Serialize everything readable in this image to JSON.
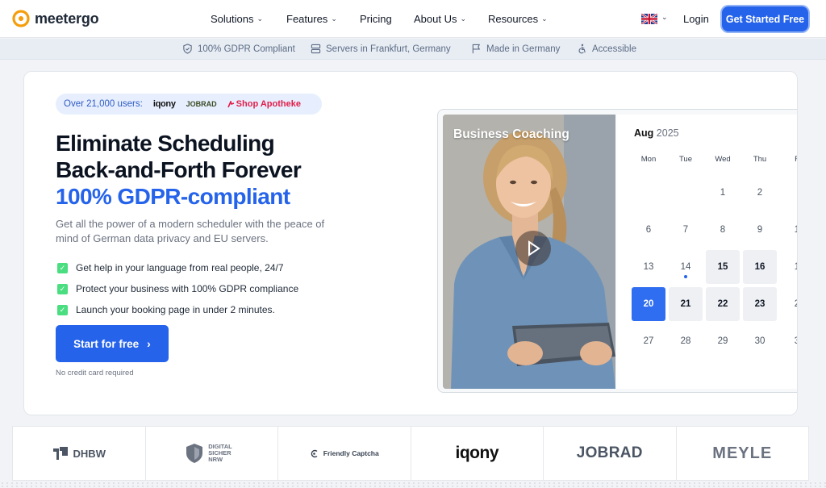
{
  "nav": {
    "logo_text": "meetergo",
    "links": [
      {
        "label": "Solutions",
        "has_dropdown": true
      },
      {
        "label": "Features",
        "has_dropdown": true
      },
      {
        "label": "Pricing",
        "has_dropdown": false
      },
      {
        "label": "About Us",
        "has_dropdown": true
      },
      {
        "label": "Resources",
        "has_dropdown": true
      }
    ],
    "language_icon": "uk-flag-icon",
    "login_label": "Login",
    "cta_label": "Get Started Free"
  },
  "trust_bar": {
    "items": [
      {
        "label": "100% GDPR Compliant",
        "icon": "shield-check-icon"
      },
      {
        "label": "Servers in Frankfurt, Germany",
        "icon": "server-icon"
      },
      {
        "label": "Made in Germany",
        "icon": "flag-icon"
      },
      {
        "label": "Accessible",
        "icon": "accessibility-icon"
      }
    ]
  },
  "hero": {
    "users_label": "Over 21,000 users:",
    "users_brands": [
      "iqony",
      "JOBRAD",
      "Shop Apotheke"
    ],
    "headline_line1": "Eliminate Scheduling",
    "headline_line2": "Back-and-Forth Forever",
    "headline_line3": "100% GDPR-compliant",
    "subtext": "Get all the power of a modern scheduler with the peace of mind of German data privacy and EU servers.",
    "checks": [
      "Get help in your language from real people, 24/7",
      "Protect your business with 100% GDPR compliance",
      "Launch your booking page in under 2 minutes."
    ],
    "start_button": "Start for free",
    "no_cc": "No credit card required"
  },
  "widget": {
    "video_title": "Business Coaching",
    "month": "Aug",
    "year": "2025",
    "weekdays": [
      "Mon",
      "Tue",
      "Wed",
      "Thu",
      "F"
    ],
    "weeks": [
      [
        null,
        null,
        "1",
        "2",
        ""
      ],
      [
        "6",
        "7",
        "8",
        "9",
        "1"
      ],
      [
        "13",
        "14",
        "15",
        "16",
        "1"
      ],
      [
        "20",
        "21",
        "22",
        "23",
        "2"
      ],
      [
        "27",
        "28",
        "29",
        "30",
        "3"
      ]
    ],
    "available_days": [
      "15",
      "16",
      "21",
      "22",
      "23"
    ],
    "selected_day": "20",
    "today_day": "14"
  },
  "logo_strip": {
    "items": [
      "DHBW",
      "DIGITAL SICHER NRW",
      "Friendly Captcha",
      "iqony",
      "JOBRAD",
      "MEYLE"
    ]
  },
  "colors": {
    "accent": "#2563eb",
    "check_green": "#4ade80"
  }
}
